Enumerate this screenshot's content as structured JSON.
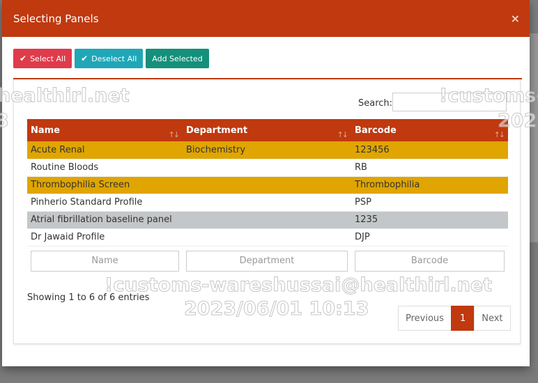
{
  "modal": {
    "title": "Selecting Panels",
    "close_symbol": "×"
  },
  "toolbar": {
    "select_all": "Select All",
    "deselect_all": "Deselect All",
    "add_selected": "Add Selected"
  },
  "search": {
    "label": "Search:",
    "value": ""
  },
  "table": {
    "headers": [
      "Name",
      "Department",
      "Barcode"
    ],
    "rows": [
      {
        "name": "Acute Renal",
        "department": "Biochemistry",
        "barcode": "123456",
        "state": "selected"
      },
      {
        "name": "Routine Bloods",
        "department": "",
        "barcode": "RB",
        "state": "normal"
      },
      {
        "name": "Thrombophilia Screen",
        "department": "",
        "barcode": "Thrombophilia",
        "state": "selected"
      },
      {
        "name": "Pinherio Standard Profile",
        "department": "",
        "barcode": "PSP",
        "state": "normal"
      },
      {
        "name": "Atrial fibrillation baseline panel",
        "department": "",
        "barcode": "1235",
        "state": "hover"
      },
      {
        "name": "Dr Jawaid Profile",
        "department": "",
        "barcode": "DJP",
        "state": "normal"
      }
    ],
    "filter_placeholders": {
      "name": "Name",
      "department": "Department",
      "barcode": "Barcode"
    }
  },
  "info": "Showing 1 to 6 of 6 entries",
  "pagination": {
    "previous": "Previous",
    "current": "1",
    "next": "Next"
  },
  "watermarks": {
    "left": "healthirl.net",
    "left_year": "3",
    "right": "!customs-w",
    "right_year": "202",
    "center": "!customs-wareshussai@healthirl.net",
    "center_date": "2023/06/01 10:13"
  },
  "colors": {
    "primary": "#c0390f",
    "selected_row": "#e0a500",
    "hover_row": "#c4c7c9",
    "select_all": "#df3b4b",
    "deselect_all": "#1fa7b7",
    "add_selected": "#14907b"
  },
  "icons": {
    "check": "check-icon",
    "sort": "sort-icon"
  }
}
